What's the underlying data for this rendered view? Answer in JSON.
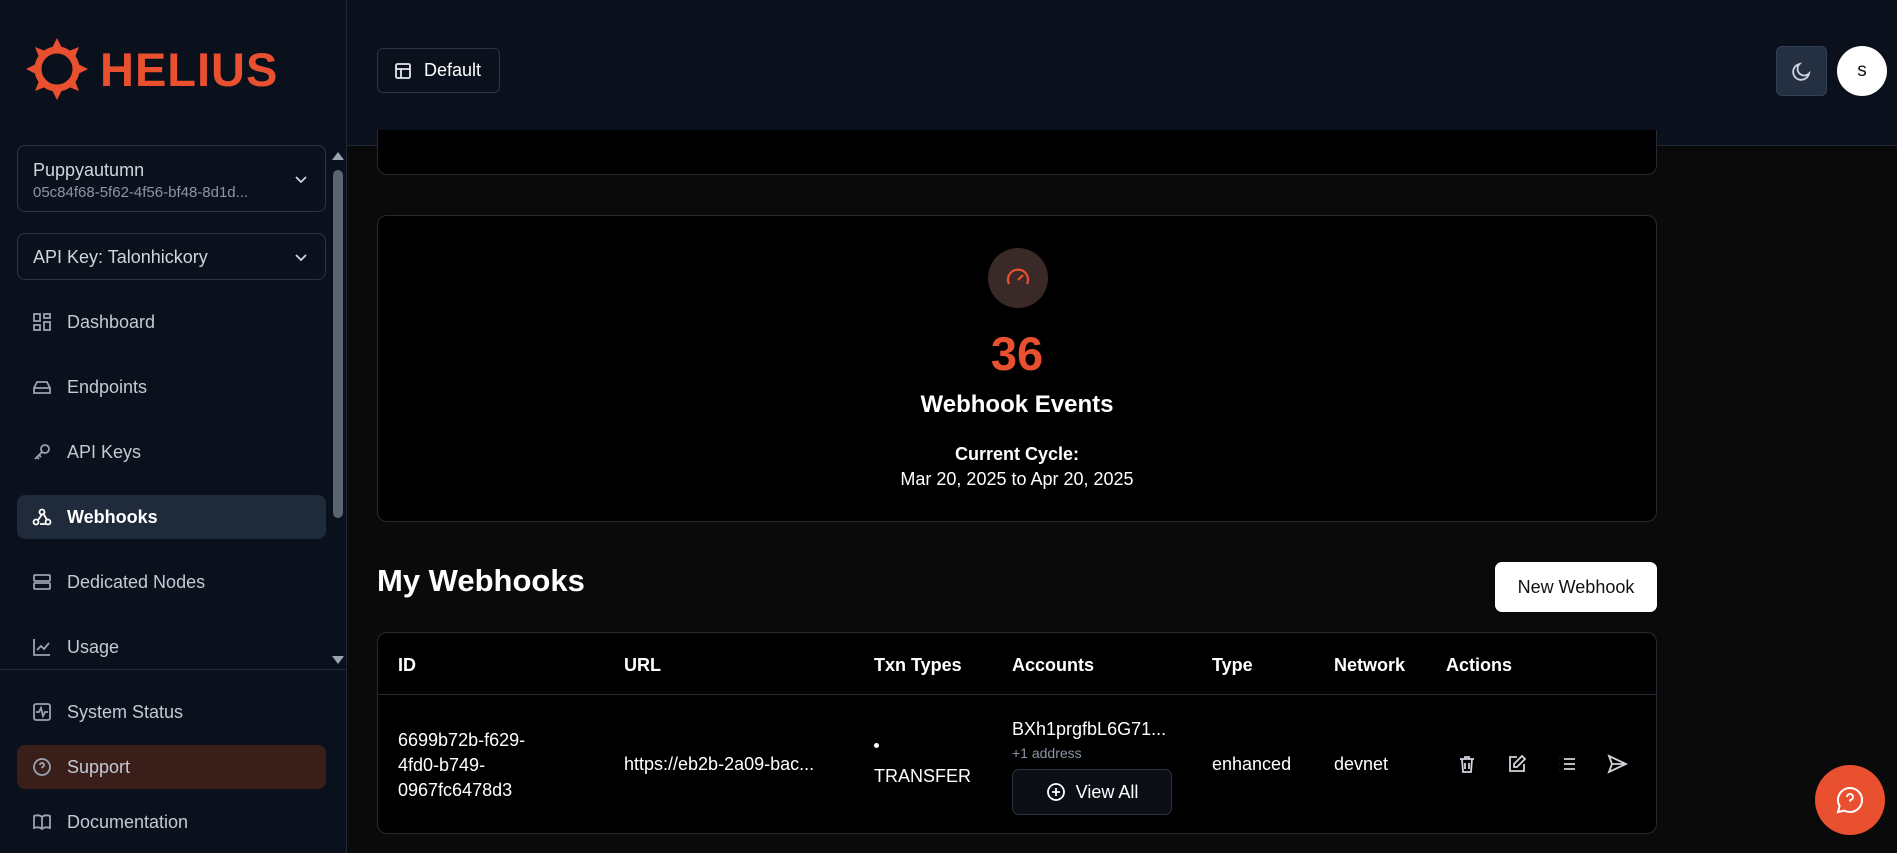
{
  "brand": {
    "name": "HELIUS",
    "accent": "#e8502f"
  },
  "sidebar": {
    "project": {
      "name": "Puppyautumn",
      "id": "05c84f68-5f62-4f56-bf48-8d1d..."
    },
    "api_key": "API Key: Talonhickory",
    "items": [
      {
        "label": "Dashboard",
        "icon": "dashboard-icon"
      },
      {
        "label": "Endpoints",
        "icon": "server-icon"
      },
      {
        "label": "API Keys",
        "icon": "key-icon"
      },
      {
        "label": "Webhooks",
        "icon": "webhook-icon",
        "active": true
      },
      {
        "label": "Dedicated Nodes",
        "icon": "nodes-icon"
      },
      {
        "label": "Usage",
        "icon": "chart-icon"
      }
    ],
    "footer": [
      {
        "label": "System Status",
        "icon": "activity-icon"
      },
      {
        "label": "Support",
        "icon": "help-circle-icon"
      },
      {
        "label": "Documentation",
        "icon": "book-icon"
      }
    ]
  },
  "topbar": {
    "workspace": "Default",
    "avatar_initial": "s"
  },
  "stats": {
    "value": "36",
    "label": "Webhook Events",
    "cycle_label": "Current Cycle:",
    "cycle_range": "Mar 20, 2025 to Apr 20, 2025"
  },
  "webhooks": {
    "title": "My Webhooks",
    "new_button": "New Webhook",
    "columns": [
      "ID",
      "URL",
      "Txn Types",
      "Accounts",
      "Type",
      "Network",
      "Actions"
    ],
    "rows": [
      {
        "id_lines": [
          "6699b72b-f629-",
          "4fd0-b749-",
          "0967fc6478d3"
        ],
        "url": "https://eb2b-2a09-bac...",
        "txn_type": "TRANSFER",
        "account": "BXh1prgfbL6G71...",
        "account_more": "+1 address",
        "view_all": "View All",
        "type": "enhanced",
        "network": "devnet"
      }
    ]
  }
}
